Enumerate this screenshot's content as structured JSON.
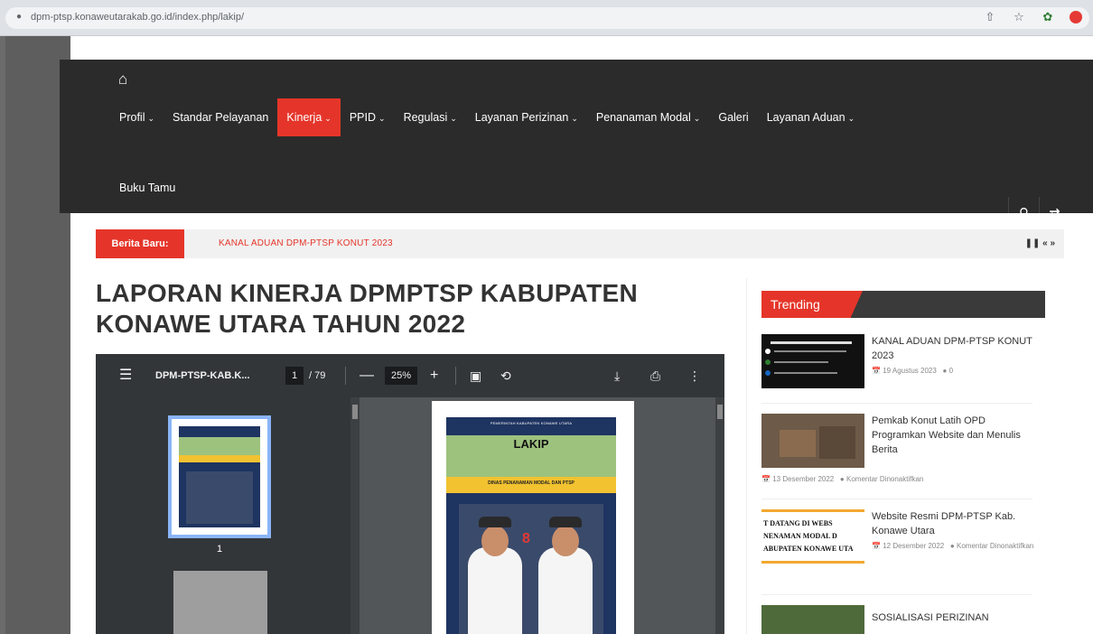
{
  "browser": {
    "url": "dpm-ptsp.konaweutarakab.go.id/index.php/lakip/"
  },
  "nav": {
    "items": [
      {
        "label": "Profil",
        "dropdown": true,
        "active": false
      },
      {
        "label": "Standar Pelayanan",
        "dropdown": false,
        "active": false
      },
      {
        "label": "Kinerja",
        "dropdown": true,
        "active": true
      },
      {
        "label": "PPID",
        "dropdown": true,
        "active": false
      },
      {
        "label": "Regulasi",
        "dropdown": true,
        "active": false
      },
      {
        "label": "Layanan Perizinan",
        "dropdown": true,
        "active": false
      },
      {
        "label": "Penanaman Modal",
        "dropdown": true,
        "active": false
      },
      {
        "label": "Galeri",
        "dropdown": false,
        "active": false
      },
      {
        "label": "Layanan Aduan",
        "dropdown": true,
        "active": false
      }
    ],
    "row2": {
      "label": "Buku Tamu"
    },
    "accent": "#e5352a"
  },
  "ticker": {
    "label": "Berita Baru:",
    "headline": "KANAL ADUAN DPM-PTSP KONUT 2023"
  },
  "page": {
    "title": "LAPORAN KINERJA DPMPTSP KABUPATEN KONAWE UTARA TAHUN 2022"
  },
  "pdf": {
    "filename": "DPM-PTSP-KAB.K...",
    "current_page": "1",
    "total_pages": "/ 79",
    "zoom": "25%",
    "thumb_page_num": "1",
    "cover_title": "LAKIP",
    "cover_header": "PEMERINTAH KABUPATEN KONAWE UTARA",
    "cover_subtitle": "DINAS PENANAMAN MODAL DAN PTSP"
  },
  "trending": {
    "label": "Trending",
    "items": [
      {
        "title": "KANAL ADUAN DPM-PTSP KONUT 2023",
        "date": "19 Agustus 2023",
        "comments": "0"
      },
      {
        "title": "Pemkab Konut Latih OPD Programkan Website dan Menulis Berita",
        "date": "13 Desember 2022",
        "comments": "Komentar Dinonaktifkan"
      },
      {
        "title": "Website Resmi DPM-PTSP Kab. Konawe Utara",
        "date": "12 Desember 2022",
        "comments": "Komentar Dinonaktifkan",
        "thumb_text": "T DATANG DI WEBS NENAMAN MODAL D ABUPATEN KONAWE UTA"
      },
      {
        "title": "SOSIALISASI PERIZINAN",
        "date": "",
        "comments": ""
      }
    ]
  }
}
